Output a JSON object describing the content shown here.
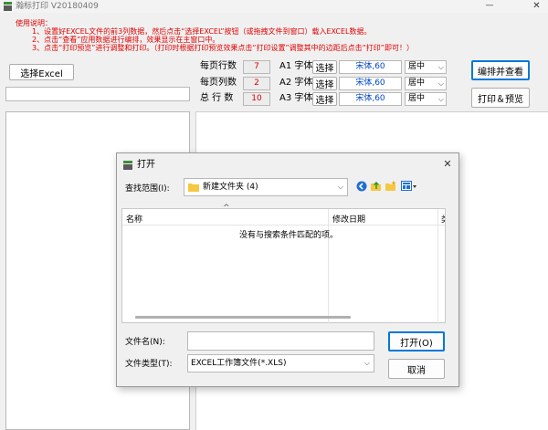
{
  "window": {
    "title": "瀚标打印 V20180409",
    "minimize_glyph": "—",
    "close_glyph": "✕"
  },
  "instructions": {
    "heading": "使用说明：",
    "line1": "1、设置好EXCEL文件的前3列数据，然后点击“选择EXCEL”按钮（或拖拽文件到窗口）载入EXCEL数据。",
    "line2": "2、点击“查看”应用数据进行编排，效果显示在主窗口中。",
    "line3": "3、点击“打印预览”进行调整和打印。（打印时根据打印预览效果点击“打印设置”调整其中的边距后点击“打印”即可！）"
  },
  "toolbar": {
    "select_excel_label": "选择Excel",
    "edit_view_label": "编排并查看",
    "print_preview_label": "打印＆预览"
  },
  "settings": {
    "rows": [
      {
        "label": "每页行数",
        "value": "7",
        "font_prefix": "A1 字体",
        "choose_label": "选择",
        "font_value": "宋体,60",
        "align": "居中"
      },
      {
        "label": "每页列数",
        "value": "2",
        "font_prefix": "A2 字体",
        "choose_label": "选择",
        "font_value": "宋体,60",
        "align": "居中"
      },
      {
        "label": "总 行 数",
        "value": "10",
        "font_prefix": "A3 字体",
        "choose_label": "选择",
        "font_value": "宋体,60",
        "align": "居中"
      }
    ]
  },
  "dialog": {
    "title": "打开",
    "close_glyph": "✕",
    "look_in_label": "查找范围(I):",
    "look_in_value": "新建文件夹 (4)",
    "columns": [
      "名称",
      "修改日期",
      "类"
    ],
    "empty_message": "没有与搜索条件匹配的项。",
    "filename_label": "文件名(N):",
    "filename_value": "",
    "filetype_label": "文件类型(T):",
    "filetype_value": "EXCEL工作簿文件(*.XLS)",
    "open_label": "打开(O)",
    "cancel_label": "取消"
  },
  "colors": {
    "accent": "#0078d7",
    "instruction_text": "#e00000",
    "font_value_text": "#0044cc",
    "folder": "#f5c842"
  }
}
